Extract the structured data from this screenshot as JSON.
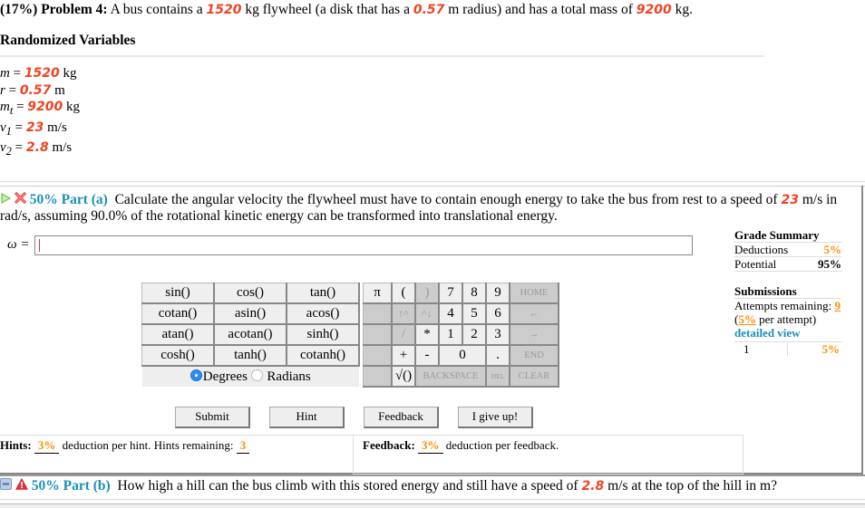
{
  "problem": {
    "weight": "(17%)",
    "label": "Problem 4:",
    "text_1": "A bus contains a",
    "mass_flywheel": "1520",
    "text_2": "kg flywheel (a disk that has a",
    "radius": "0.57",
    "text_3": "m radius) and has a total mass of",
    "mass_total": "9200",
    "text_4": "kg."
  },
  "randomized": {
    "heading": "Randomized Variables",
    "variables": [
      {
        "symbol": "m",
        "sub": "",
        "value": "1520",
        "unit": "kg"
      },
      {
        "symbol": "r",
        "sub": "",
        "value": "0.57",
        "unit": "m"
      },
      {
        "symbol": "m",
        "sub": "t",
        "value": "9200",
        "unit": "kg"
      },
      {
        "symbol": "v",
        "sub": "1",
        "value": "23",
        "unit": "m/s"
      },
      {
        "symbol": "v",
        "sub": "2",
        "value": "2.8",
        "unit": "m/s"
      }
    ]
  },
  "partA": {
    "percent": "50%",
    "label": "Part (a)",
    "text_1": "Calculate the angular velocity the flywheel must have to contain enough energy to take the bus from rest to a speed of",
    "speed": "23",
    "text_2": "m/s in rad/s, assuming 90.0% of the rotational kinetic energy can be transformed into translational energy.",
    "answer_label": "ω =",
    "answer_value": ""
  },
  "grade_summary": {
    "heading": "Grade Summary",
    "deductions_label": "Deductions",
    "deductions_value": "5%",
    "potential_label": "Potential",
    "potential_value": "95%"
  },
  "submissions": {
    "heading": "Submissions",
    "attempts_label": "Attempts remaining:",
    "attempts_value": "9",
    "per_attempt_value": "5%",
    "per_attempt_text": "per attempt)",
    "detailed_view": "detailed view",
    "history": [
      {
        "attempt": "1",
        "deduction": "5%"
      }
    ]
  },
  "keypad": {
    "functions": [
      [
        "sin()",
        "cos()",
        "tan()"
      ],
      [
        "cotan()",
        "asin()",
        "acos()"
      ],
      [
        "atan()",
        "acotan()",
        "sinh()"
      ],
      [
        "cosh()",
        "tanh()",
        "cotanh()"
      ]
    ],
    "mode_degrees": "Degrees",
    "mode_radians": "Radians",
    "mode_selected": "Degrees",
    "keys": {
      "pi": "π",
      "open_paren": "(",
      "close_paren": ")",
      "up": "↑^",
      "down": "^↓",
      "slash": "/",
      "star": "*",
      "plus": "+",
      "minus": "-",
      "sqrt": "√()",
      "d7": "7",
      "d8": "8",
      "d9": "9",
      "d4": "4",
      "d5": "5",
      "d6": "6",
      "d1": "1",
      "d2": "2",
      "d3": "3",
      "d0": "0",
      "dot": ".",
      "home": "HOME",
      "left": "←",
      "right": "→",
      "end": "END",
      "backspace": "BACKSPACE",
      "del": "DEL",
      "clear": "CLEAR"
    }
  },
  "actions": {
    "submit": "Submit",
    "hint": "Hint",
    "feedback": "Feedback",
    "give_up": "I give up!"
  },
  "hints": {
    "label": "Hints:",
    "deduction": "3%",
    "text": "deduction per hint. Hints remaining:",
    "remaining": "3"
  },
  "feedback": {
    "label": "Feedback:",
    "deduction": "3%",
    "text": "deduction per feedback."
  },
  "partB": {
    "percent": "50%",
    "label": "Part (b)",
    "text_1": "How high a hill can the bus climb with this stored energy and still have a speed of",
    "speed": "2.8",
    "text_2": "m/s at the top of the hill in m?"
  },
  "colors": {
    "variable": "#ee4422",
    "deduction": "#ff8c00",
    "part_label": "#1b8fb5",
    "radio_selected": "#2d8cf0"
  }
}
